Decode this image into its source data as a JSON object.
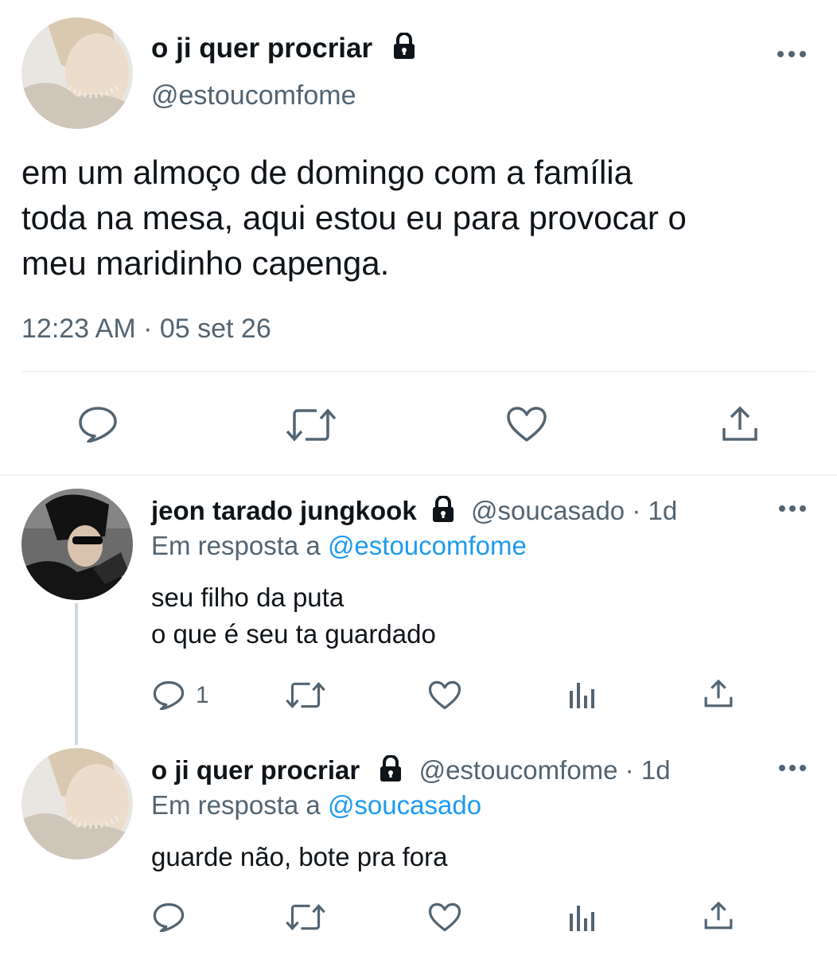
{
  "main_tweet": {
    "display_name": "o ji quer procriar",
    "handle": "@estoucomfome",
    "text_lines": [
      "em um almoço de domingo com a família",
      "toda na mesa, aqui estou eu para provocar o",
      "meu maridinho capenga."
    ],
    "timestamp": "12:23 AM · 05 set 26",
    "actions": [
      "reply-icon",
      "retweet-icon",
      "like-icon",
      "share-icon"
    ]
  },
  "replies": [
    {
      "display_name": "jeon tarado jungkook",
      "handle_time": "@soucasado · 1d",
      "replying_label": "Em resposta a",
      "replying_to": "@estoucomfome",
      "text_lines": [
        "seu filho da puta",
        "o que é seu ta guardado"
      ],
      "reply_count": "1"
    },
    {
      "display_name": "o ji quer procriar",
      "handle_time": "@estoucomfome · 1d",
      "replying_label": "Em resposta a",
      "replying_to": "@soucasado",
      "text_lines": [
        "guarde não, bote pra fora"
      ],
      "reply_count": ""
    }
  ],
  "colors": {
    "text": "#0f1419",
    "secondary": "#536471",
    "accent": "#1d9bf0",
    "divider": "#eff3f4"
  }
}
